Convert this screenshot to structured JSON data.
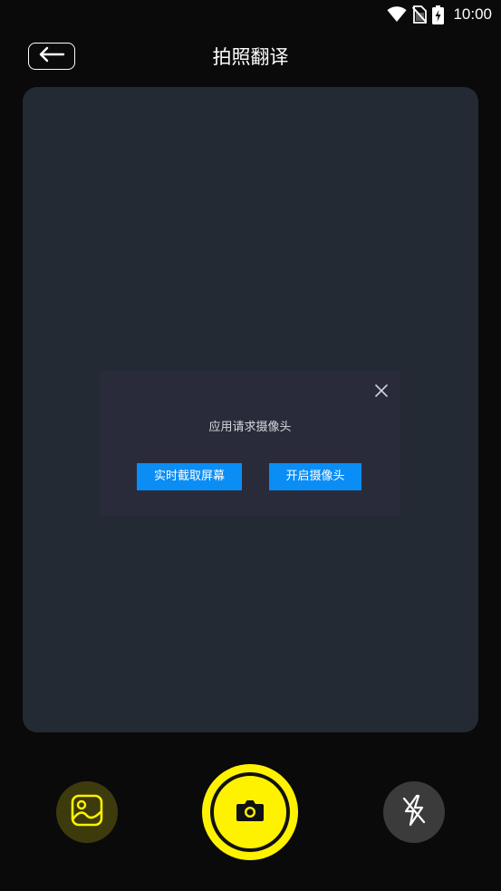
{
  "status_bar": {
    "time": "10:00",
    "icons": [
      "wifi-icon",
      "no-sim-icon",
      "battery-charging-icon"
    ]
  },
  "header": {
    "back_icon": "arrow-left-icon",
    "title": "拍照翻译"
  },
  "dialog": {
    "message": "应用请求摄像头",
    "close_icon": "close-icon",
    "screen_capture_label": "实时截取屏幕",
    "open_camera_label": "开启摄像头",
    "button_color": "#0a8df5"
  },
  "controls": {
    "gallery_icon": "image-gallery-icon",
    "shutter_icon": "camera-icon",
    "flash_icon": "flash-off-icon",
    "accent_color": "#fff200"
  }
}
